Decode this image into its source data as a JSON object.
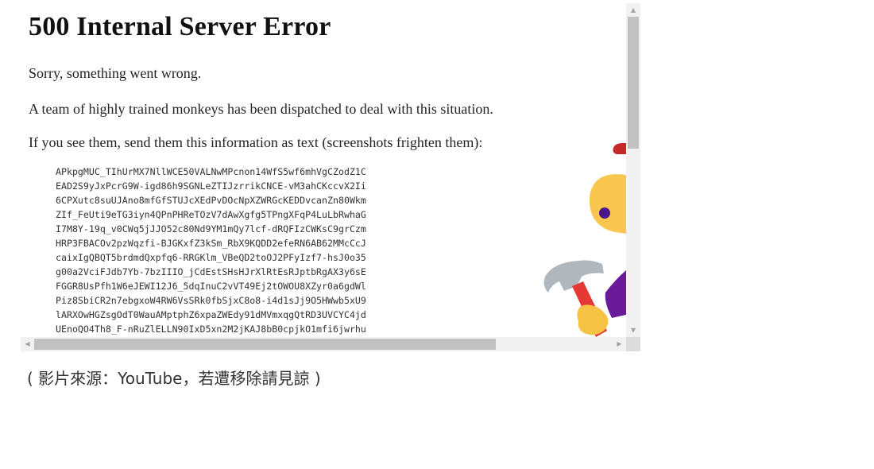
{
  "page": {
    "heading": "500 Internal Server Error",
    "paragraphs": [
      "Sorry, something went wrong.",
      "A team of highly trained monkeys has been dispatched to deal with this situation.",
      "If you see them, send them this information as text (screenshots frighten them):"
    ],
    "code_lines": [
      "APkpgMUC_TIhUrMX7NllWCE50VALNwMPcnon14WfS5wf6mhVgCZodZ1C",
      "EAD2S9yJxPcrG9W-igd86h9SGNLeZTIJzrrikCNCE-vM3ahCKccvX2Ii",
      "6CPXutc8suUJAno8mfGfSTUJcXEdPvDOcNpXZWRGcKEDDvcanZn80Wkm",
      "ZIf_FeUti9eTG3iyn4QPnPHReTOzV7dAwXgfg5TPngXFqP4LuLbRwhaG",
      "I7M8Y-19q_v0CWq5jJJO52c80Nd9YM1mQy7lcf-dRQFIzCWKsC9grCzm",
      "HRP3FBACOv2pzWqzfi-BJGKxfZ3kSm_RbX9KQDD2efeRN6AB62MMcCcJ",
      "caixIgQBQT5brdmdQxpfq6-RRGKlm_VBeQD2toOJ2PFyIzf7-hsJ0o35",
      "g00a2VciFJdb7Yb-7bzIIIO_jCdEstSHsHJrXlRtEsRJptbRgAX3y6sE",
      "FGGR8UsPfh1W6eJEWI12J6_5dqInuC2vVT49Ej2tOWOU8XZyr0a6gdWl",
      "Piz8SbiCR2n7ebgxoW4RW6VsSRk0fbSjxC8o8-i4d1sJj9O5HWwb5xU9",
      "lARXOwHGZsgOdT0WauAMptphZ6xpaZWEdy91dMVmxqgQtRD3UVCYC4jd",
      "UEnoQO4Th8_F-nRuZlELLN90IxD5xn2M2jKAJ8bB0cpjkO1mfi6jwrhu"
    ]
  },
  "caption": "( 影片來源：YouTube，若遭移除請見諒 )",
  "icons": {
    "scroll_up": "arrow-up-icon",
    "scroll_down": "arrow-down-icon",
    "scroll_left": "arrow-left-icon",
    "scroll_right": "arrow-right-icon",
    "illustration": "monkey-hammer-illustration"
  },
  "colors": {
    "monkey_face": "#f9c74f",
    "hammer_head": "#b0b7bd",
    "hammer_handle": "#e53935",
    "sleeve": "#6a1b9a",
    "hand": "#f6c243"
  }
}
